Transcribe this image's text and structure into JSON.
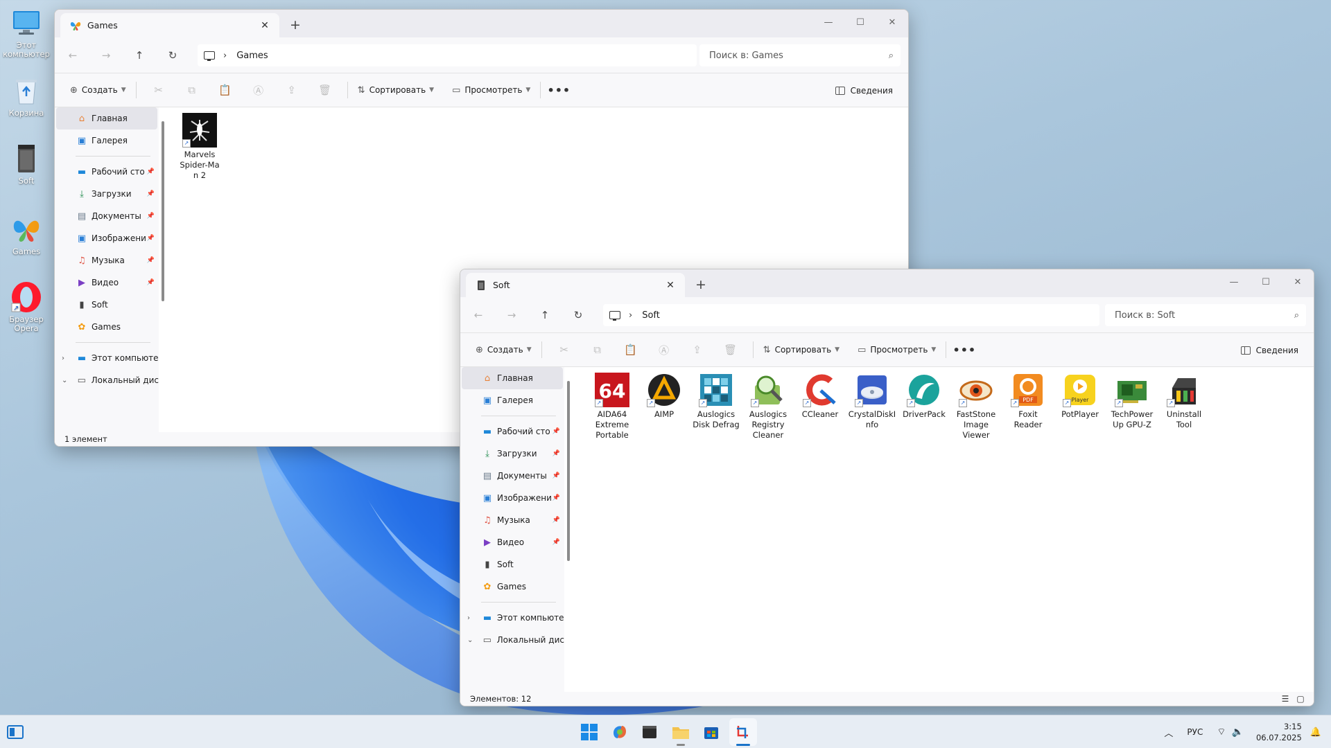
{
  "desktop": {
    "icons": [
      {
        "label": "Этот компьютер",
        "icon": "monitor-icon"
      },
      {
        "label": "Корзина",
        "icon": "recycle-bin-icon"
      },
      {
        "label": "Soft",
        "icon": "archive-icon"
      },
      {
        "label": "Games",
        "icon": "butterfly-icon"
      },
      {
        "label": "Браузер Opera",
        "icon": "opera-icon"
      }
    ]
  },
  "games_window": {
    "tab_title": "Games",
    "breadcrumb": "Games",
    "search_placeholder": "Поиск в: Games",
    "toolbar": {
      "create": "Создать",
      "sort": "Сортировать",
      "view": "Просмотреть",
      "more": "•••",
      "details": "Сведения"
    },
    "nav": {
      "home": "Главная",
      "gallery": "Галерея",
      "pinned": [
        "Рабочий сто",
        "Загрузки",
        "Документы",
        "Изображени",
        "Музыка",
        "Видео"
      ],
      "soft": "Soft",
      "games": "Games",
      "this_pc": "Этот компьюте",
      "local_disk": "Локальный дис"
    },
    "files": [
      {
        "name": "Marvels Spider-Man 2",
        "label_lines": [
          "Marvels",
          "Spider-Ma",
          "n 2"
        ]
      }
    ],
    "status": "1 элемент"
  },
  "soft_window": {
    "tab_title": "Soft",
    "breadcrumb": "Soft",
    "search_placeholder": "Поиск в: Soft",
    "toolbar": {
      "create": "Создать",
      "sort": "Сортировать",
      "view": "Просмотреть",
      "more": "•••",
      "details": "Сведения"
    },
    "nav": {
      "home": "Главная",
      "gallery": "Галерея",
      "pinned": [
        "Рабочий сто",
        "Загрузки",
        "Документы",
        "Изображени",
        "Музыка",
        "Видео"
      ],
      "soft": "Soft",
      "games": "Games",
      "this_pc": "Этот компьюте",
      "local_disk": "Локальный дис"
    },
    "files": [
      {
        "label_lines": [
          "AIDA64",
          "Extreme",
          "Portable"
        ],
        "icon": "aida64-icon"
      },
      {
        "label_lines": [
          "AIMP"
        ],
        "icon": "aimp-icon"
      },
      {
        "label_lines": [
          "Auslogics",
          "Disk Defrag"
        ],
        "icon": "disk-defrag-icon"
      },
      {
        "label_lines": [
          "Auslogics",
          "Registry",
          "Cleaner"
        ],
        "icon": "registry-cleaner-icon"
      },
      {
        "label_lines": [
          "CCleaner"
        ],
        "icon": "ccleaner-icon"
      },
      {
        "label_lines": [
          "CrystalDiskI",
          "nfo"
        ],
        "icon": "crystaldiskinfo-icon"
      },
      {
        "label_lines": [
          "DriverPack"
        ],
        "icon": "driverpack-icon"
      },
      {
        "label_lines": [
          "FastStone",
          "Image",
          "Viewer"
        ],
        "icon": "faststone-icon"
      },
      {
        "label_lines": [
          "Foxit",
          "Reader"
        ],
        "icon": "foxit-icon"
      },
      {
        "label_lines": [
          "PotPlayer"
        ],
        "icon": "potplayer-icon"
      },
      {
        "label_lines": [
          "TechPower",
          "Up GPU-Z"
        ],
        "icon": "gpuz-icon"
      },
      {
        "label_lines": [
          "Uninstall",
          "Tool"
        ],
        "icon": "uninstall-tool-icon"
      }
    ],
    "status": "Элементов: 12"
  },
  "taskbar": {
    "apps": [
      "widgets-icon",
      "start-icon",
      "copilot-icon",
      "terminal-icon",
      "file-explorer-icon",
      "store-icon",
      "snipping-tool-icon"
    ],
    "language": "РУС",
    "time": "3:15",
    "date": "06.07.2025"
  },
  "colors": {
    "accent": "#0078d4",
    "folder": "#f3c24d"
  }
}
